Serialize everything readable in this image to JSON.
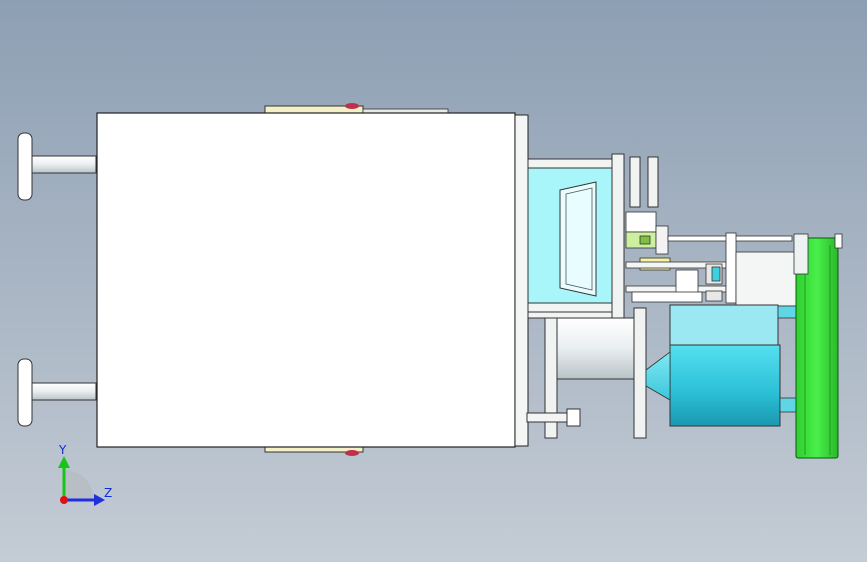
{
  "app": {
    "view": "cad-model-viewport"
  },
  "triad": {
    "y_label": "Y",
    "z_label": "Z"
  },
  "colors": {
    "background_top": "#8d9fb4",
    "background_bottom": "#c4ccd5",
    "housing": "#ffffff",
    "cyan_part": "#a8f6fa",
    "motor_cyan": "#2fc3d8",
    "green_wheel": "#3ce43c",
    "axis_y": "#19c419",
    "axis_z": "#1f2fe0",
    "axis_x": "#e01010"
  }
}
